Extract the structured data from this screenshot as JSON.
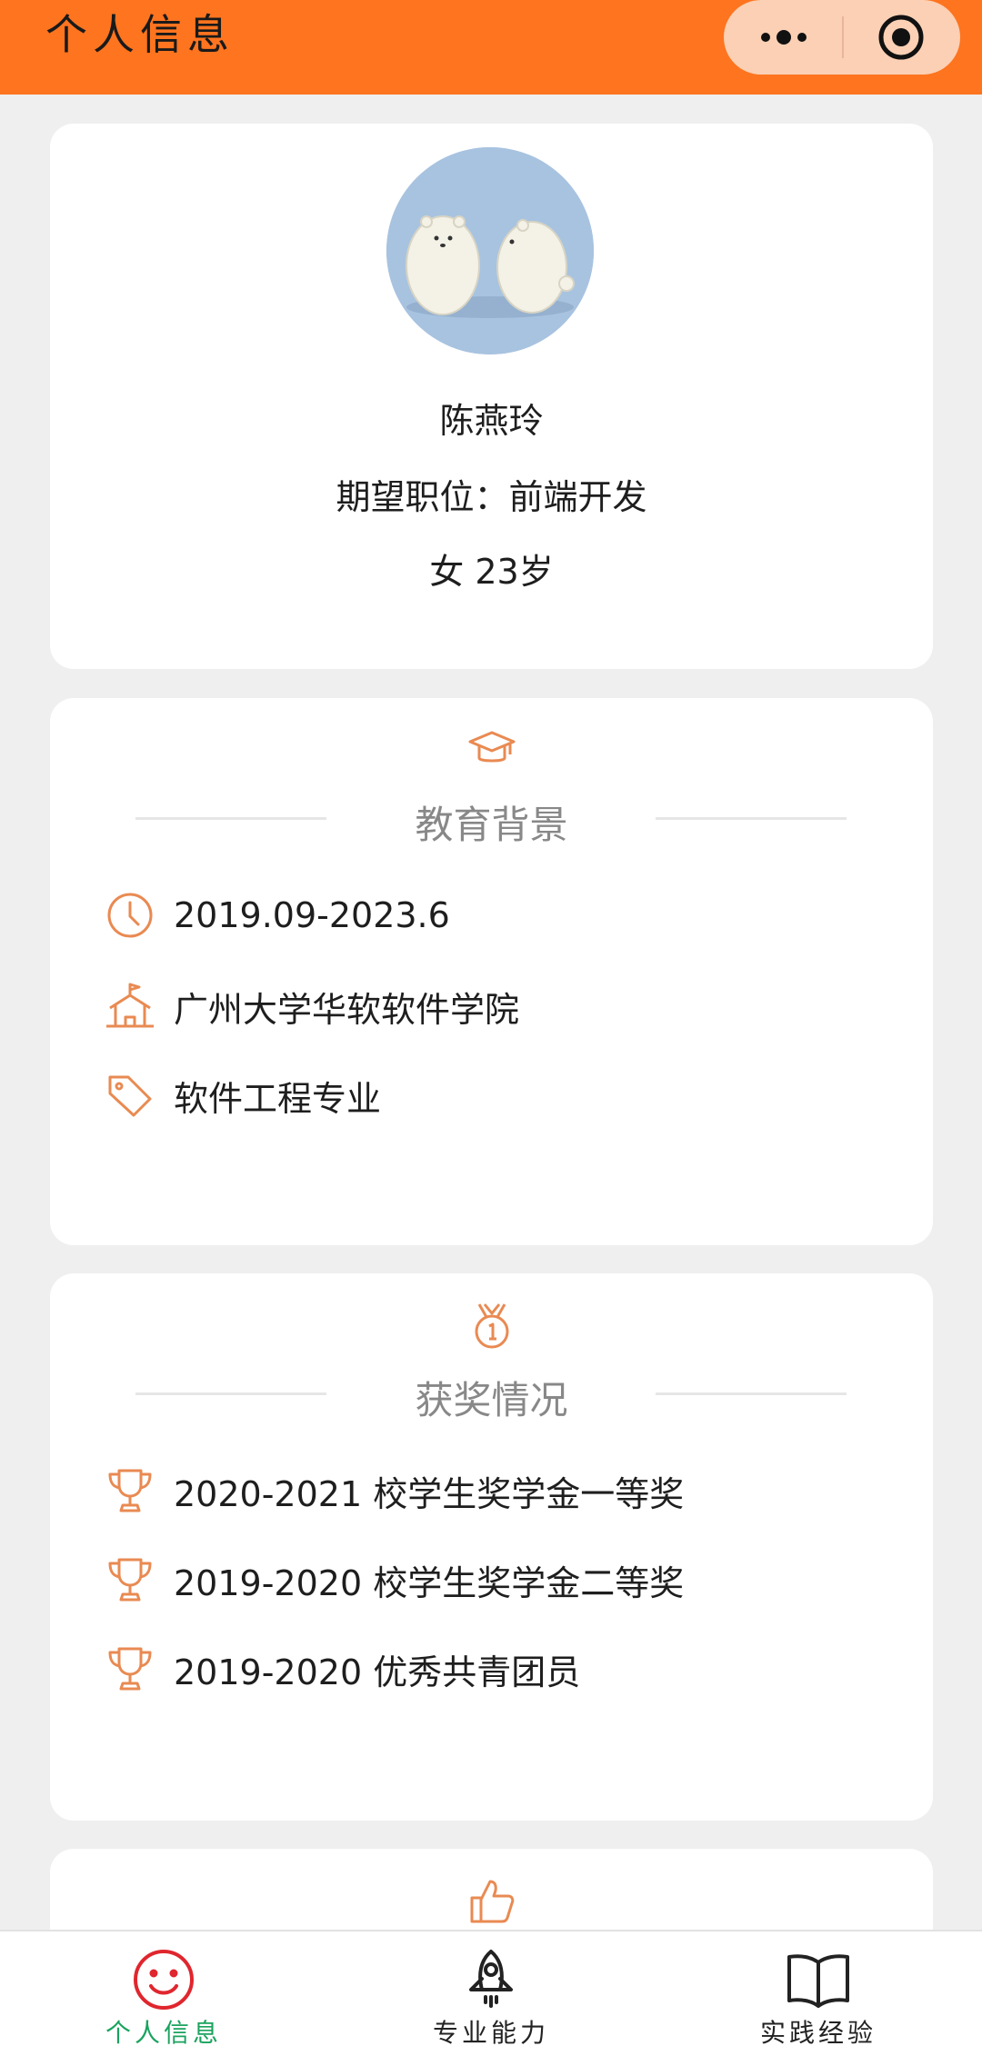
{
  "header": {
    "title": "个人信息"
  },
  "profile": {
    "name": "陈燕玲",
    "job": "期望职位：前端开发",
    "info": "女 23岁"
  },
  "education": {
    "title": "教育背景",
    "icon": "graduation-cap-icon",
    "items": [
      {
        "icon": "clock-icon",
        "text": "2019.09-2023.6"
      },
      {
        "icon": "school-icon",
        "text": "广州大学华软软件学院"
      },
      {
        "icon": "tag-icon",
        "text": "软件工程专业"
      }
    ]
  },
  "awards": {
    "title": "获奖情况",
    "icon": "medal-icon",
    "items": [
      {
        "icon": "trophy-icon",
        "text": "2020-2021 校学生奖学金一等奖"
      },
      {
        "icon": "trophy-icon",
        "text": "2019-2020 校学生奖学金二等奖"
      },
      {
        "icon": "trophy-icon",
        "text": "2019-2020 优秀共青团员"
      }
    ]
  },
  "skills": {
    "icon": "thumbs-up-icon"
  },
  "tabbar": {
    "items": [
      {
        "label": "个人信息",
        "icon": "smile-icon",
        "active": true
      },
      {
        "label": "专业能力",
        "icon": "rocket-icon",
        "active": false
      },
      {
        "label": "实践经验",
        "icon": "book-icon",
        "active": false
      }
    ]
  },
  "colors": {
    "accent": "#fe741f",
    "icon": "#e98a52",
    "active_tab": "#1aa35e",
    "active_icon": "#e0262e"
  }
}
